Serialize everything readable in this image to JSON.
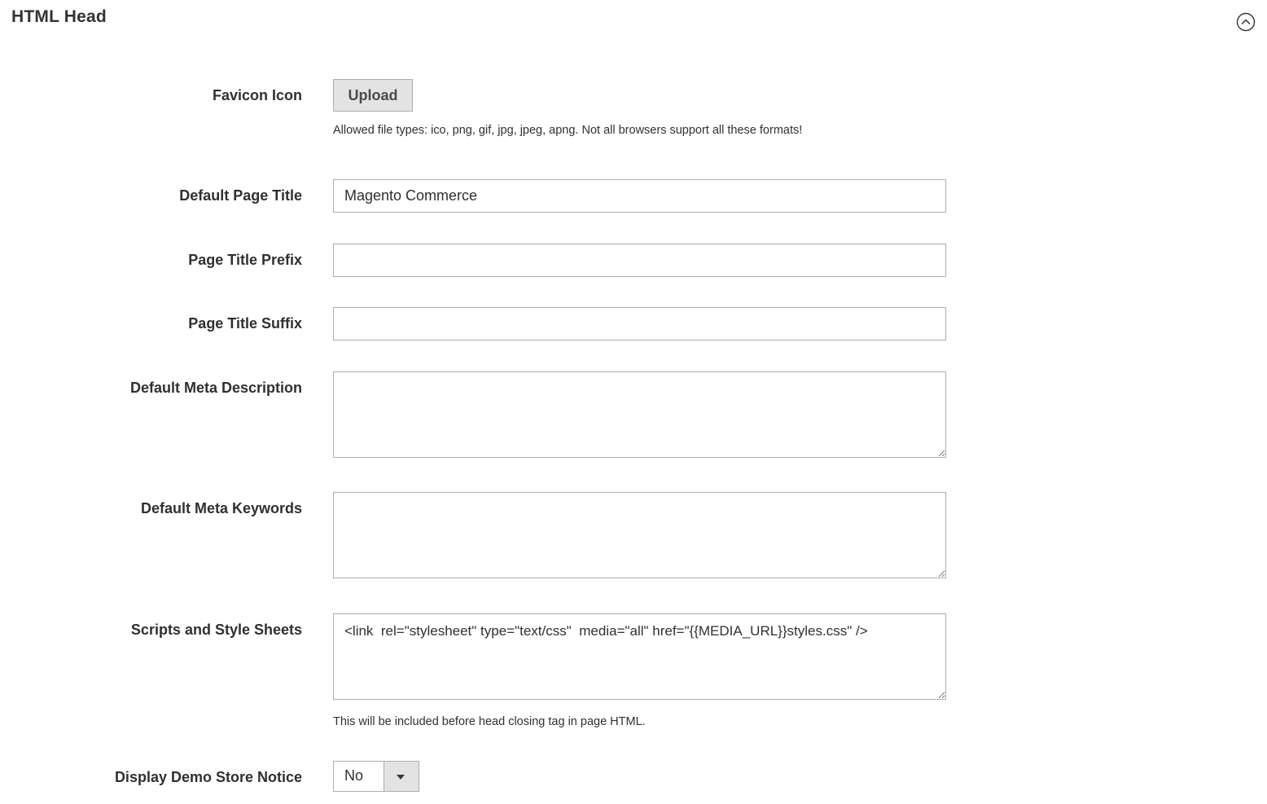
{
  "section": {
    "title": "HTML Head",
    "collapse_icon": "chevron-up-circle-icon"
  },
  "fields": {
    "favicon": {
      "label": "Favicon Icon",
      "button_label": "Upload",
      "note": "Allowed file types: ico, png, gif, jpg, jpeg, apng. Not all browsers support all these formats!"
    },
    "default_title": {
      "label": "Default Page Title",
      "value": "Magento Commerce"
    },
    "title_prefix": {
      "label": "Page Title Prefix",
      "value": ""
    },
    "title_suffix": {
      "label": "Page Title Suffix",
      "value": ""
    },
    "meta_description": {
      "label": "Default Meta Description",
      "value": ""
    },
    "meta_keywords": {
      "label": "Default Meta Keywords",
      "value": ""
    },
    "scripts": {
      "label": "Scripts and Style Sheets",
      "value": "<link  rel=\"stylesheet\" type=\"text/css\"  media=\"all\" href=\"{{MEDIA_URL}}styles.css\" />",
      "note": "This will be included before head closing tag in page HTML."
    },
    "demo_notice": {
      "label": "Display Demo Store Notice",
      "selected": "No",
      "arrow_icon": "caret-down-icon"
    }
  }
}
